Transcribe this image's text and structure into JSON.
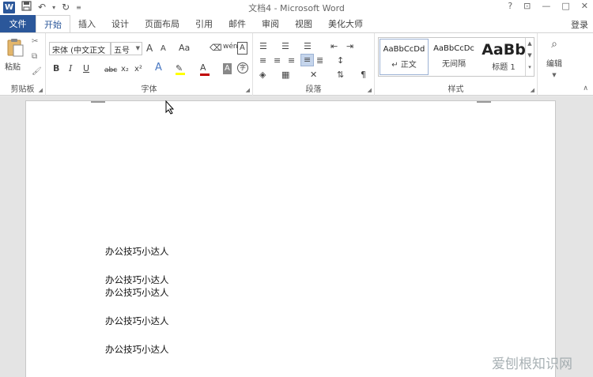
{
  "window": {
    "title": "文档4 - Microsoft Word",
    "logo_letter": "W",
    "controls": {
      "help": "?",
      "ribbon_opts": "⊡",
      "minimize": "—",
      "maximize": "□",
      "close": "✕"
    }
  },
  "qat": {
    "save": "💾",
    "undo": "↶",
    "undo_drop": "▾",
    "redo": "↻",
    "customize": "≡"
  },
  "tabs": {
    "file": "文件",
    "items": [
      "开始",
      "插入",
      "设计",
      "页面布局",
      "引用",
      "邮件",
      "审阅",
      "视图",
      "美化大师"
    ],
    "active_index": 0,
    "login": "登录"
  },
  "ribbon": {
    "clipboard": {
      "label": "剪贴板",
      "paste": "粘贴"
    },
    "font": {
      "label": "字体",
      "font_name": "宋体 (中文正文",
      "font_size": "五号",
      "grow": "A",
      "shrink": "A",
      "case": "Aa",
      "bold": "B",
      "italic": "I",
      "underline": "U",
      "strike": "abc",
      "subscript": "x₂",
      "superscript": "x²",
      "effects": "A",
      "font_color": "A",
      "shading": "A",
      "phonetic": "wén",
      "border_char": "A",
      "enclose": "字"
    },
    "paragraph": {
      "label": "段落"
    },
    "styles": {
      "label": "样式",
      "items": [
        {
          "sample": "AaBbCcDd",
          "name": "↵ 正文"
        },
        {
          "sample": "AaBbCcDc",
          "name": "无间隔"
        },
        {
          "sample": "AaBb",
          "name": "标题 1"
        }
      ]
    },
    "editing": {
      "label": "编辑"
    }
  },
  "document": {
    "lines": [
      "办公技巧小达人",
      "办公技巧小达人",
      "办公技巧小达人",
      "办公技巧小达人",
      "办公技巧小达人"
    ]
  },
  "watermark": "爱刨根知识网",
  "colors": {
    "accent": "#2b579a",
    "font_color_bar": "#c00000",
    "highlight_bar": "#ffff00"
  }
}
